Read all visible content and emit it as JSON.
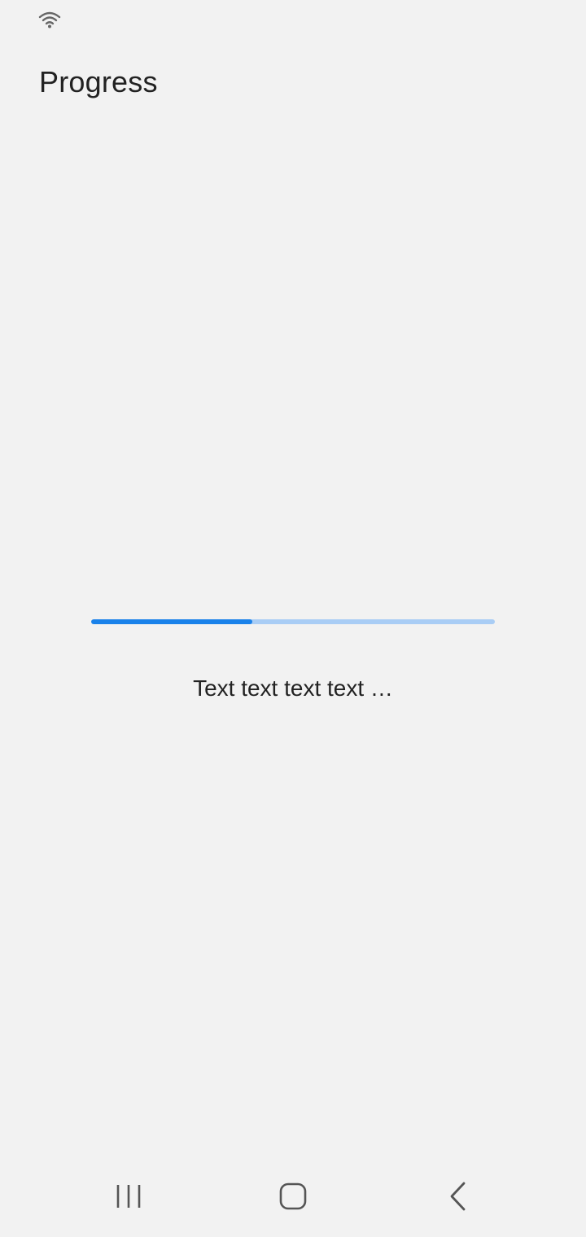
{
  "status_bar": {
    "wifi_icon": "wifi-icon"
  },
  "page": {
    "title": "Progress"
  },
  "progress": {
    "value_percent": 40,
    "text": "Text text text text …",
    "fill_color": "#1a82ea",
    "track_color": "#a9cdf5"
  },
  "nav_bar": {
    "recents_icon": "recents-icon",
    "home_icon": "home-icon",
    "back_icon": "back-icon"
  }
}
